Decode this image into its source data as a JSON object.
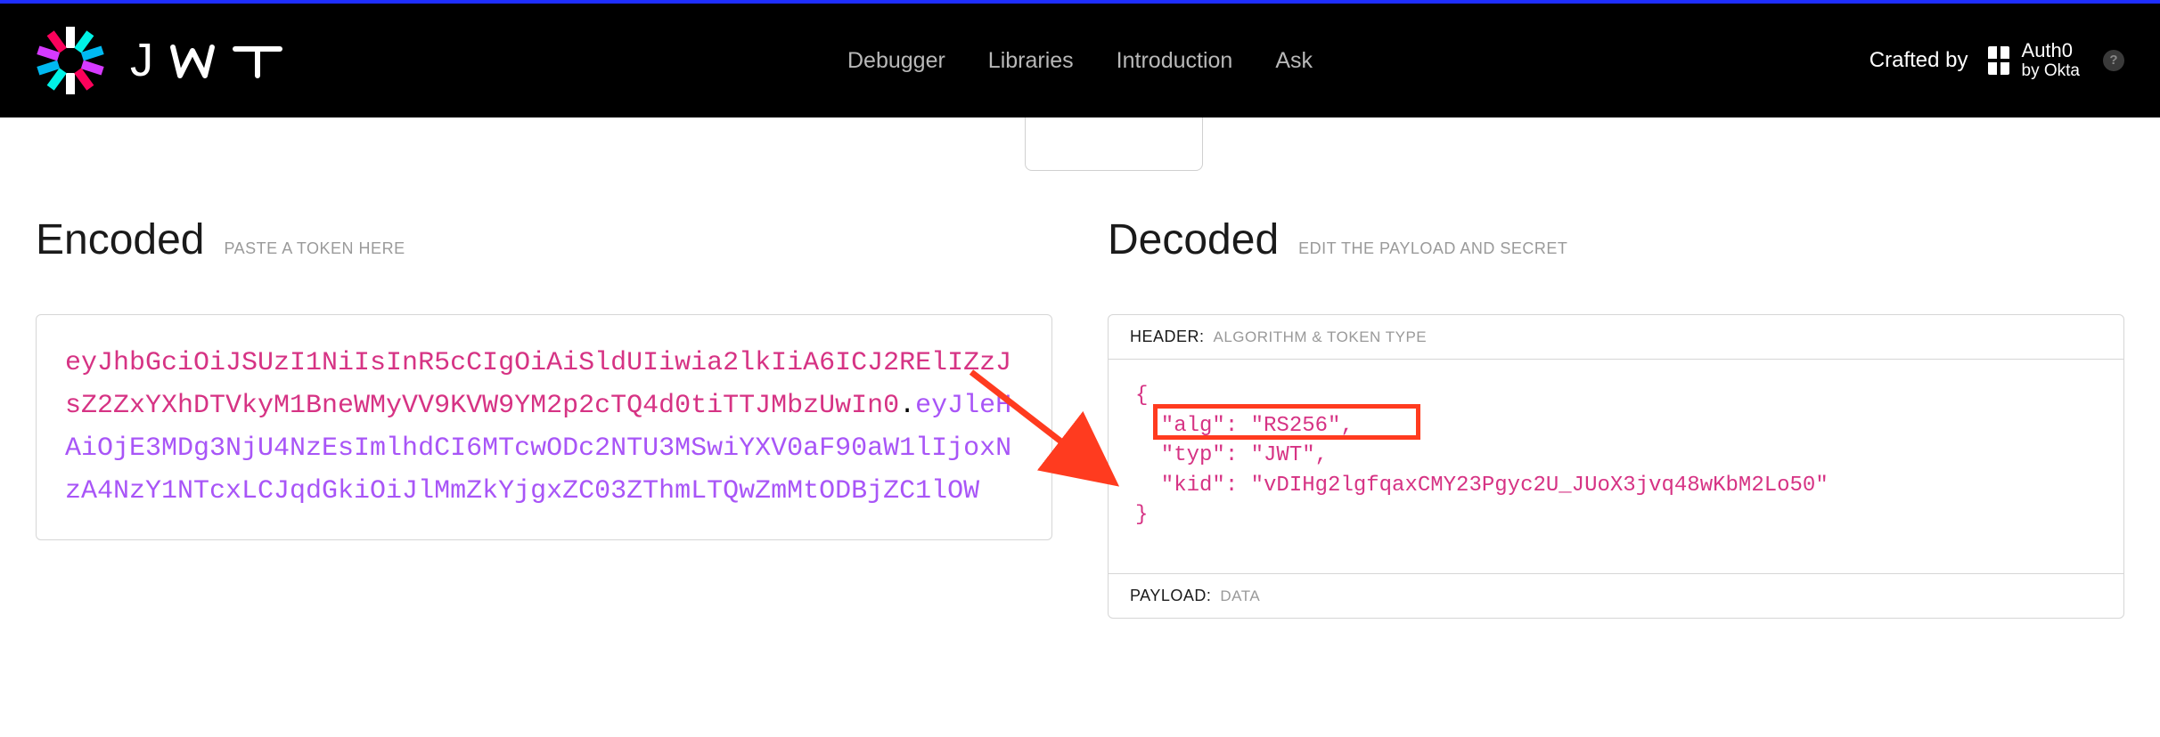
{
  "nav": {
    "links": {
      "debugger": "Debugger",
      "libraries": "Libraries",
      "introduction": "Introduction",
      "ask": "Ask"
    },
    "crafted_by": "Crafted by",
    "auth0": {
      "main": "Auth0",
      "sub": "by Okta"
    }
  },
  "encoded": {
    "title": "Encoded",
    "subtitle": "PASTE A TOKEN HERE",
    "token_header": "eyJhbGciOiJSUzI1NiIsInR5cCIgOiAiSldUIiwia2lkIiA6ICJ2RElIZzJsZ2ZxYXhDTVkyM1BneWMyVV9KVW9YM2p2cTQ4d0tiTTJMbzUwIn0",
    "token_dot": ".",
    "token_payload": "eyJleHAiOjE3MDg3NjU4NzEsImlhdCI6MTcwODc2NTU3MSwiYXV0aF90aW1lIjoxNzA4NzY1NTcxLCJqdGkiOiJlMmZkYjgxZC03ZThmLTQwZmMtODBjZC1lOW"
  },
  "decoded": {
    "title": "Decoded",
    "subtitle": "EDIT THE PAYLOAD AND SECRET",
    "header_label": "HEADER:",
    "header_sublabel": "ALGORITHM & TOKEN TYPE",
    "payload_label": "PAYLOAD:",
    "payload_sublabel": "DATA",
    "json": {
      "open": "{",
      "alg": "  \"alg\": \"RS256\",",
      "typ": "  \"typ\": \"JWT\",",
      "kid": "  \"kid\": \"vDIHg2lgfqaxCMY23Pgyc2U_JUoX3jvq48wKbM2Lo50\"",
      "close": "}"
    }
  }
}
